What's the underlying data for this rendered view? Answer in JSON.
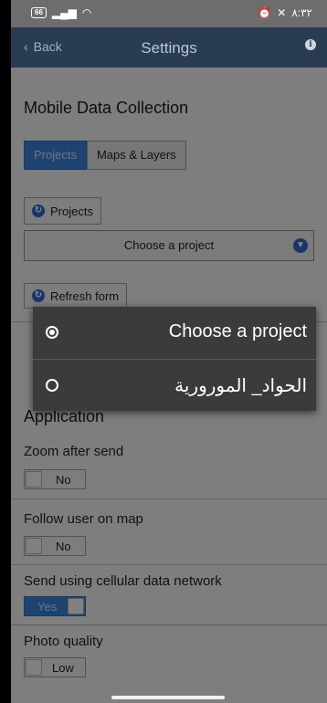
{
  "status_bar": {
    "battery": "66",
    "time": "٨:٣٢"
  },
  "nav": {
    "back_label": "Back",
    "title": "Settings"
  },
  "mobile_data": {
    "title": "Mobile Data Collection",
    "tabs": [
      {
        "label": "Projects",
        "active": true
      },
      {
        "label": "Maps & Layers",
        "active": false
      }
    ],
    "projects_button": "Projects",
    "project_select": "Choose a project",
    "refresh_button": "Refresh form"
  },
  "application": {
    "title": "Application",
    "settings": [
      {
        "label": "Zoom after send",
        "value": "No"
      },
      {
        "label": "Follow user on map",
        "value": "No"
      },
      {
        "label": "Send using cellular data network",
        "value": "Yes"
      },
      {
        "label": "Photo quality",
        "value": "Low"
      }
    ]
  },
  "dialog": {
    "options": [
      {
        "label": "Choose a project",
        "selected": true
      },
      {
        "label": "الحواد_ المورورية",
        "selected": false
      }
    ]
  },
  "colors": {
    "nav_bg": "#2a3c54",
    "accent": "#3a7fd6",
    "dialog_bg": "#3b3b3b"
  }
}
